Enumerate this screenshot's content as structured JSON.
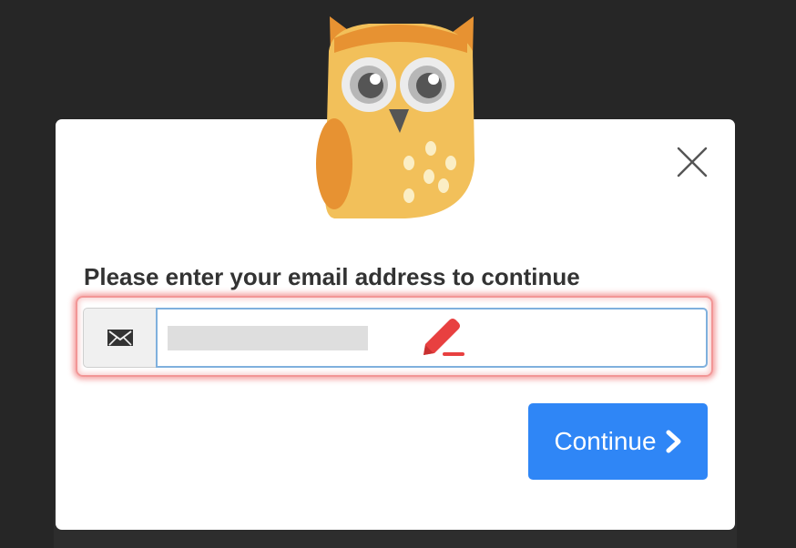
{
  "dialog": {
    "prompt": "Please enter your email address to continue",
    "email_input": {
      "value": "",
      "placeholder": ""
    },
    "continue_label": "Continue"
  },
  "icons": {
    "close": "close-icon",
    "mail": "envelope-icon",
    "edit": "pencil-icon",
    "continue": "chevron-right-icon",
    "mascot": "owl-mascot"
  },
  "colors": {
    "background": "#262626",
    "primary": "#2f86f6",
    "highlight": "#e84040",
    "owl_body": "#f2c05a",
    "owl_accent": "#e79232"
  }
}
